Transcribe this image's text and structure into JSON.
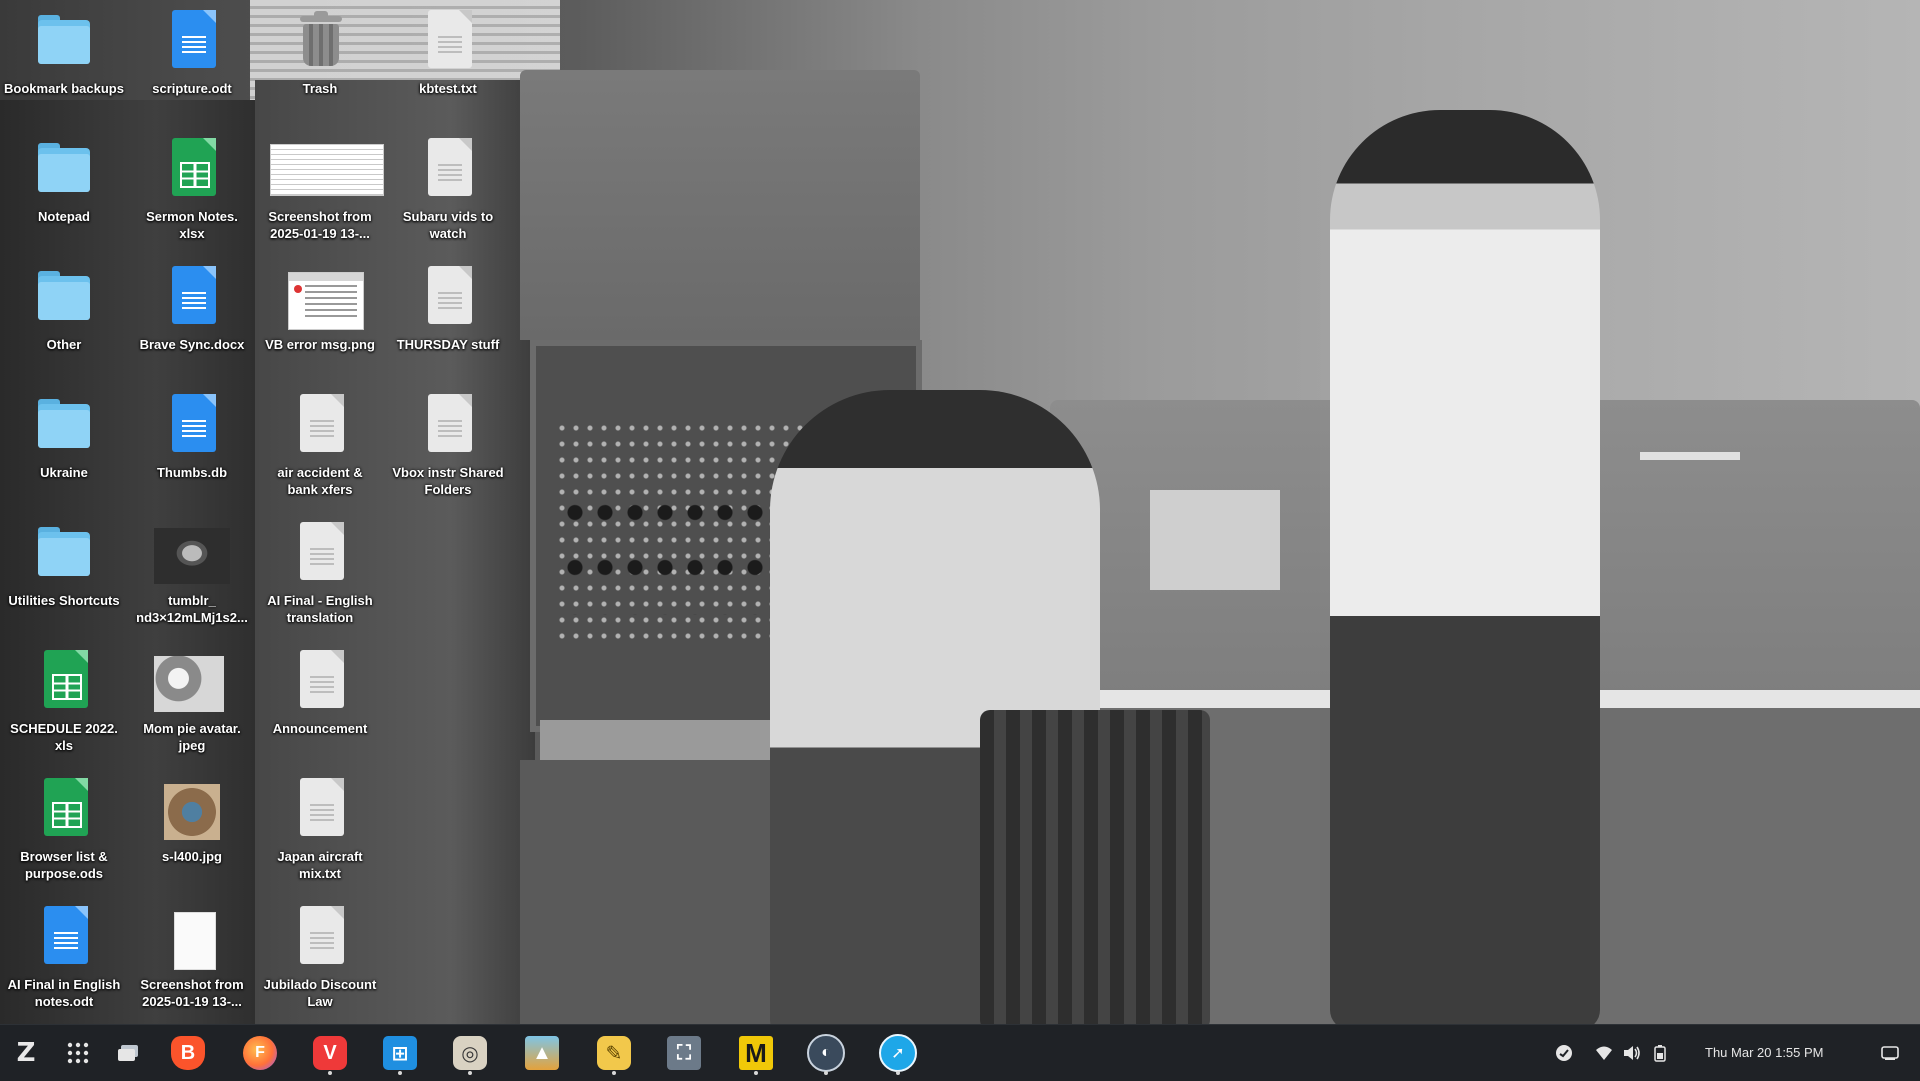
{
  "desktop": {
    "icons": [
      {
        "label": "Bookmark backups",
        "type": "folder"
      },
      {
        "label": "scripture.odt",
        "type": "doc-blue"
      },
      {
        "label": "Trash",
        "type": "trash"
      },
      {
        "label": "kbtest.txt",
        "type": "doc-grey"
      },
      {
        "label": "Notepad",
        "type": "folder"
      },
      {
        "label": "Sermon Notes.\nxlsx",
        "type": "doc-green"
      },
      {
        "label": "Screenshot from\n2025-01-19 13-...",
        "type": "image"
      },
      {
        "label": "Subaru vids to\nwatch",
        "type": "doc-grey"
      },
      {
        "label": "Other",
        "type": "folder"
      },
      {
        "label": "Brave Sync.docx",
        "type": "doc-blue"
      },
      {
        "label": "VB error msg.png",
        "type": "image"
      },
      {
        "label": "THURSDAY stuff",
        "type": "doc-grey"
      },
      {
        "label": "Ukraine",
        "type": "folder"
      },
      {
        "label": "Thumbs.db",
        "type": "doc-blue"
      },
      {
        "label": "air accident &\nbank xfers",
        "type": "doc-grey"
      },
      {
        "label": "Vbox instr Shared\nFolders",
        "type": "doc-grey"
      },
      {
        "label": "Utilities Shortcuts",
        "type": "folder"
      },
      {
        "label": "tumblr_\nnd3×12mLMj1s2...",
        "type": "image"
      },
      {
        "label": "AI Final - English\ntranslation",
        "type": "doc-grey"
      },
      {
        "label": "SCHEDULE 2022.\nxls",
        "type": "doc-green"
      },
      {
        "label": "Mom pie avatar.\njpeg",
        "type": "image"
      },
      {
        "label": "Announcement",
        "type": "doc-grey"
      },
      {
        "label": "Browser list &\npurpose.ods",
        "type": "doc-green"
      },
      {
        "label": "s-l400.jpg",
        "type": "image"
      },
      {
        "label": "Japan aircraft\nmix.txt",
        "type": "doc-grey"
      },
      {
        "label": "AI Final in English\nnotes.odt",
        "type": "doc-blue"
      },
      {
        "label": "Screenshot from\n2025-01-19 13-...",
        "type": "image"
      },
      {
        "label": "Jubilado Discount\nLaw",
        "type": "doc-grey"
      }
    ]
  },
  "taskbar": {
    "apps": [
      {
        "name": "zorin-menu-icon",
        "glyph": "Z"
      },
      {
        "name": "app-grid-icon",
        "glyph": "⋮⋮⋮"
      },
      {
        "name": "workspaces-icon",
        "glyph": "▭"
      },
      {
        "name": "brave-browser-icon",
        "glyph": "B",
        "color": "#fb542b"
      },
      {
        "name": "firefox-icon",
        "glyph": "F",
        "color": "#ff7139"
      },
      {
        "name": "vivaldi-icon",
        "glyph": "V",
        "color": "#ef3939"
      },
      {
        "name": "software-store-icon",
        "glyph": "⊞",
        "color": "#1f8fe0"
      },
      {
        "name": "image-viewer-icon",
        "glyph": "◎",
        "color": "#d9d2c2"
      },
      {
        "name": "photos-icon",
        "glyph": "▲",
        "color": "#e4a23c"
      },
      {
        "name": "text-editor-icon",
        "glyph": "✎",
        "color": "#f2c84b"
      },
      {
        "name": "screenshot-icon",
        "glyph": "⛶",
        "color": "#6c7a89"
      },
      {
        "name": "mail-m-icon",
        "glyph": "M",
        "color": "#f0c808"
      },
      {
        "name": "disk-usage-icon",
        "glyph": "◐",
        "color": "#3a4a5c"
      },
      {
        "name": "safari-like-browser-icon",
        "glyph": "➚",
        "color": "#1ea7e8"
      }
    ],
    "tray": {
      "clock": "Thu Mar 20   1:55 PM"
    }
  }
}
